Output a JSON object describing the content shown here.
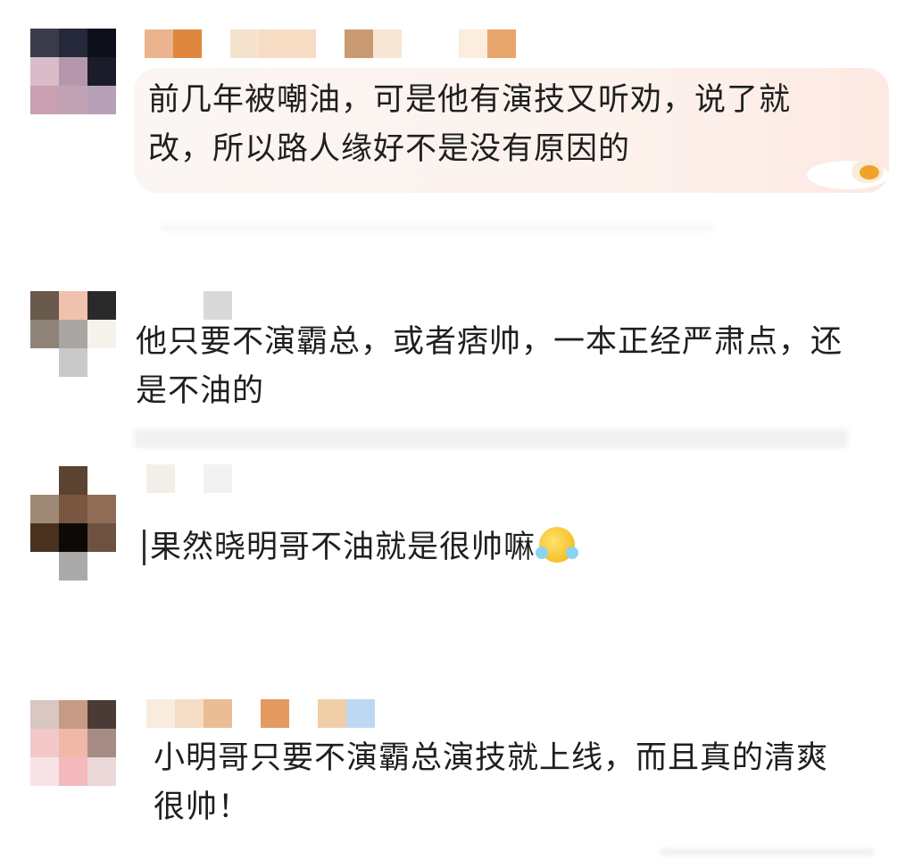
{
  "comments": [
    {
      "text_lines": [
        "前几年被嘲油，可是他有演技又听劝，说了就",
        "改，所以路人缘好不是没有原因的"
      ]
    },
    {
      "text_lines": [
        "他只要不演霸总，或者痞帅，一本正经严肃点，还",
        "是不油的"
      ]
    },
    {
      "text_lines": [
        "果然晓明哥不油就是很帅嘛"
      ],
      "emoji": "crying-face-emoji"
    },
    {
      "text_lines": [
        "小明哥只要不演霸总演技就上线，而且真的清爽",
        "很帅！"
      ]
    }
  ],
  "colors": {
    "avatar1": [
      "#3a3b4a",
      "#252838",
      "#0d0f1a",
      "#d9bcc8",
      "#b497ac",
      "#1b1c2a",
      "#c8a0b2",
      "#c0a2b5",
      "#b7a1b6"
    ],
    "avatar2": [
      "#6a5a4e",
      "#f0c2ad",
      "#2a2a2a",
      "#8f8377",
      "#a9a5a0",
      "#f6f2ec",
      "#ffffff",
      "#c9c9c9",
      "#ffffff"
    ],
    "avatar3": [
      "#ffffff",
      "#5b4331",
      "#ffffff",
      "#9f8a76",
      "#7a553f",
      "#8e6c55",
      "#48321f",
      "#0d0906",
      "#6e5140",
      "#ffffff",
      "#a9a9a9",
      "#ffffff"
    ],
    "avatar4": [
      "#d8c7c2",
      "#c59b85",
      "#4a3b37",
      "#f2c8c8",
      "#f0b8a6",
      "#a68c84",
      "#f7e3e6",
      "#f3b9bd",
      "#e9d8d7"
    ],
    "name1": [
      "#e9b48e",
      "#e0873e",
      "#ffffff",
      "#f6e3cf",
      "#f5dcc2",
      "#f5dcc2",
      "#ffffff",
      "#c99a72",
      "#f7e6d3",
      "#ffffff",
      "#ffffff",
      "#fbeedf",
      "#e8a56b"
    ],
    "name3": [
      "#f4eee9",
      "#ffffff",
      "#f2f2f2"
    ],
    "name4": [
      "#f9ecdf",
      "#f6ddc5",
      "#ebbd97",
      "#ffffff",
      "#e59a62",
      "#ffffff",
      "#f0cfa8",
      "#bcd8f2"
    ]
  }
}
